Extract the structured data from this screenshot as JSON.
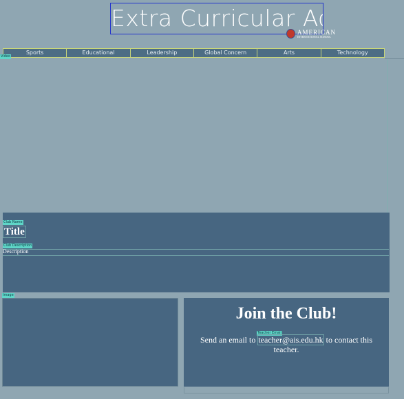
{
  "header": {
    "banner_title": "Extra Curricular Activities",
    "logo": {
      "line1": "AMERICAN",
      "line2": "INTERNATIONAL SCHOOL"
    }
  },
  "nav": {
    "items": [
      "Sports",
      "Educational",
      "Leadership",
      "Global Concern",
      "Arts",
      "Technology"
    ]
  },
  "labels": {
    "video": "Video",
    "club_name": "Club Name",
    "club_description": "Club Description",
    "image": "Image",
    "teacher_email": "Teacher Email"
  },
  "club": {
    "title": "Title",
    "description": "Description"
  },
  "join": {
    "heading": "Join the Club!",
    "text_before": "Send an email to",
    "email": "teacher@ais.edu.hk",
    "text_after": "to contact this teacher."
  },
  "colors": {
    "page_bg": "#8fa6b2",
    "panel_bg": "#476681",
    "nav_bg": "#4d6d84",
    "tag_bg": "#5fd6c8"
  }
}
